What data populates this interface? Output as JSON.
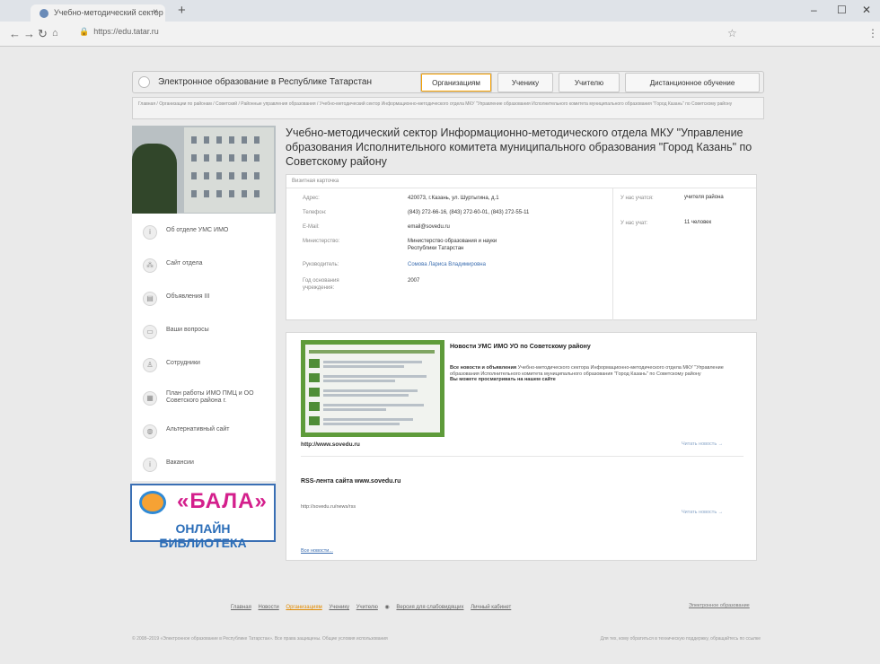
{
  "browser": {
    "tab_title": "Учебно-методический сектор",
    "url": "https://edu.tatar.ru",
    "window_controls": [
      "–",
      "☐",
      "✕"
    ]
  },
  "site": {
    "title": "Электронное образование в Республике Татарстан",
    "nav": [
      "Организациям",
      "Ученику",
      "Учителю",
      "Дистанционное обучение"
    ],
    "breadcrumb": "Главная / Организации по районам / Советский / Районные управления образования / Учебно-методический сектор Информационно-методического отдела МКУ \"Управление образования Исполнительного комитета муниципального образования \"Город Казань\" по Советскому району"
  },
  "sidebar": {
    "items": [
      "Об отделе УМС ИМО",
      "Сайт отдела",
      "Объявления ІІІ",
      "Ваши вопросы",
      "Сотрудники",
      "План работы ИМО ПМЦ и ОО Советского района г.",
      "Альтернативный сайт",
      "Вакансии"
    ],
    "banner_title": "«БАЛА»",
    "banner_subtitle": "ОНЛАЙН БИБЛИОТЕКА"
  },
  "main": {
    "title": "Учебно-методический сектор Информационно-методического отдела МКУ \"Управление образования Исполнительного комитета муниципального образования \"Город Казань\" по Советскому району",
    "card": {
      "header": "Визитная карточка",
      "fields": [
        {
          "key": "Адрес:",
          "value": "420073, г.Казань, ул. Шуртыгина, д.1"
        },
        {
          "key": "Телефон:",
          "value": "(843) 272-66-16, (843) 272-60-01, (843) 272-55-11"
        },
        {
          "key": "E-Mail:",
          "value": "email@sovedu.ru"
        },
        {
          "key": "Министерство:",
          "value": "Министерство образования и науки Республики Татарстан"
        },
        {
          "key": "Руководитель:",
          "value": "Сомова Лариса Владимировна"
        },
        {
          "key": "Год основания учреждения:",
          "value": "2007"
        }
      ],
      "side": [
        {
          "key": "У нас учатся:",
          "value": "учителя района"
        },
        {
          "key": "У нас учат:",
          "value": "11 человек"
        }
      ]
    },
    "news": {
      "title": "Новости УМС ИМО УО по Советскому району",
      "desc_bold": "Все новости и объявления",
      "desc": " Учебно-методического сектора Информационно-методического отдела МКУ \"Управление образования Исполнительного комитета муниципального образования \"Город Казань\" по Советскому району",
      "desc_bold2": "Вы можете просматривать на нашем сайте",
      "url": "http://www.sovedu.ru",
      "more": "Читать новость →",
      "rss_title": "RSS-лента сайта www.sovedu.ru",
      "rss_url": "http://sovedu.ru/news/rss",
      "rss_more": "Читать новость →",
      "all_news": "Все новости..."
    }
  },
  "footer": {
    "nav": [
      "Главная",
      "Новости",
      "Организациям",
      "Ученику",
      "Учителю",
      "Версия для слабовидящих",
      "Личный кабинет"
    ],
    "right": "Электронное образование",
    "copyright": "© 2008–2019 «Электронное образование в Республике Татарстан». Все права защищены. Общие условия использования",
    "support": "Для тех, кому обратиться в техническую поддержку, обращайтесь по ссылке"
  }
}
